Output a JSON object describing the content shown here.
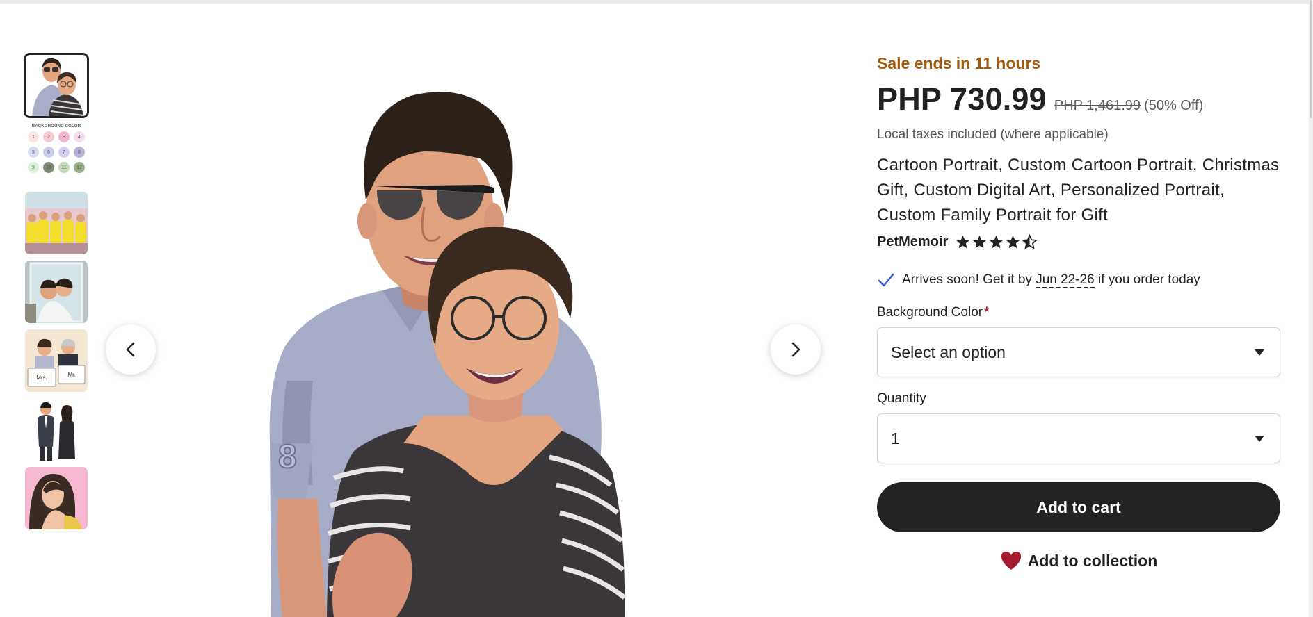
{
  "thumbnails": [
    {
      "name": "thumb-couple-portrait",
      "active": true
    },
    {
      "name": "thumb-background-color",
      "title": "BACKGROUND COLOR",
      "dots": [
        {
          "n": "1",
          "c": "#fde3e1"
        },
        {
          "n": "2",
          "c": "#f7c9cf"
        },
        {
          "n": "3",
          "c": "#f3b6d2"
        },
        {
          "n": "4",
          "c": "#f6dcec"
        },
        {
          "n": "5",
          "c": "#d7dcf1"
        },
        {
          "n": "6",
          "c": "#c8cdeb"
        },
        {
          "n": "7",
          "c": "#d8cff0"
        },
        {
          "n": "8",
          "c": "#b6b3d8"
        },
        {
          "n": "9",
          "c": "#d9f1d6"
        },
        {
          "n": "10",
          "c": "#7d8a74"
        },
        {
          "n": "11",
          "c": "#c2d9b5"
        },
        {
          "n": "12",
          "c": "#9cb08a"
        }
      ]
    },
    {
      "name": "thumb-group-yellow-shirts"
    },
    {
      "name": "thumb-framed-couple"
    },
    {
      "name": "thumb-mr-mrs-signs"
    },
    {
      "name": "thumb-formal-couple"
    },
    {
      "name": "thumb-pink-portrait"
    }
  ],
  "viewer": {
    "prev_icon": "chevron-left-icon",
    "next_icon": "chevron-right-icon"
  },
  "product": {
    "sale_text": "Sale ends in 11 hours",
    "price": "PHP 730.99",
    "original_price": "PHP 1,461.99",
    "discount": "(50% Off)",
    "tax_note": "Local taxes included (where applicable)",
    "title": "Cartoon Portrait, Custom Cartoon Portrait, Christmas Gift, Custom Digital Art, Personalized Portrait, Custom Family Portrait for Gift",
    "shop_name": "PetMemoir",
    "rating": 4.5,
    "arrive_prefix": "Arrives soon! Get it by ",
    "arrive_date": "Jun 22-26",
    "arrive_suffix": " if you order today",
    "background_label": "Background Color",
    "required_mark": "*",
    "background_select": "Select an option",
    "quantity_label": "Quantity",
    "quantity_value": "1",
    "add_to_cart": "Add to cart",
    "add_to_collection": "Add to collection"
  },
  "colors": {
    "sale": "#a2590b",
    "button": "#222222",
    "heart": "#a61a2e",
    "check": "#2f5bd3"
  }
}
